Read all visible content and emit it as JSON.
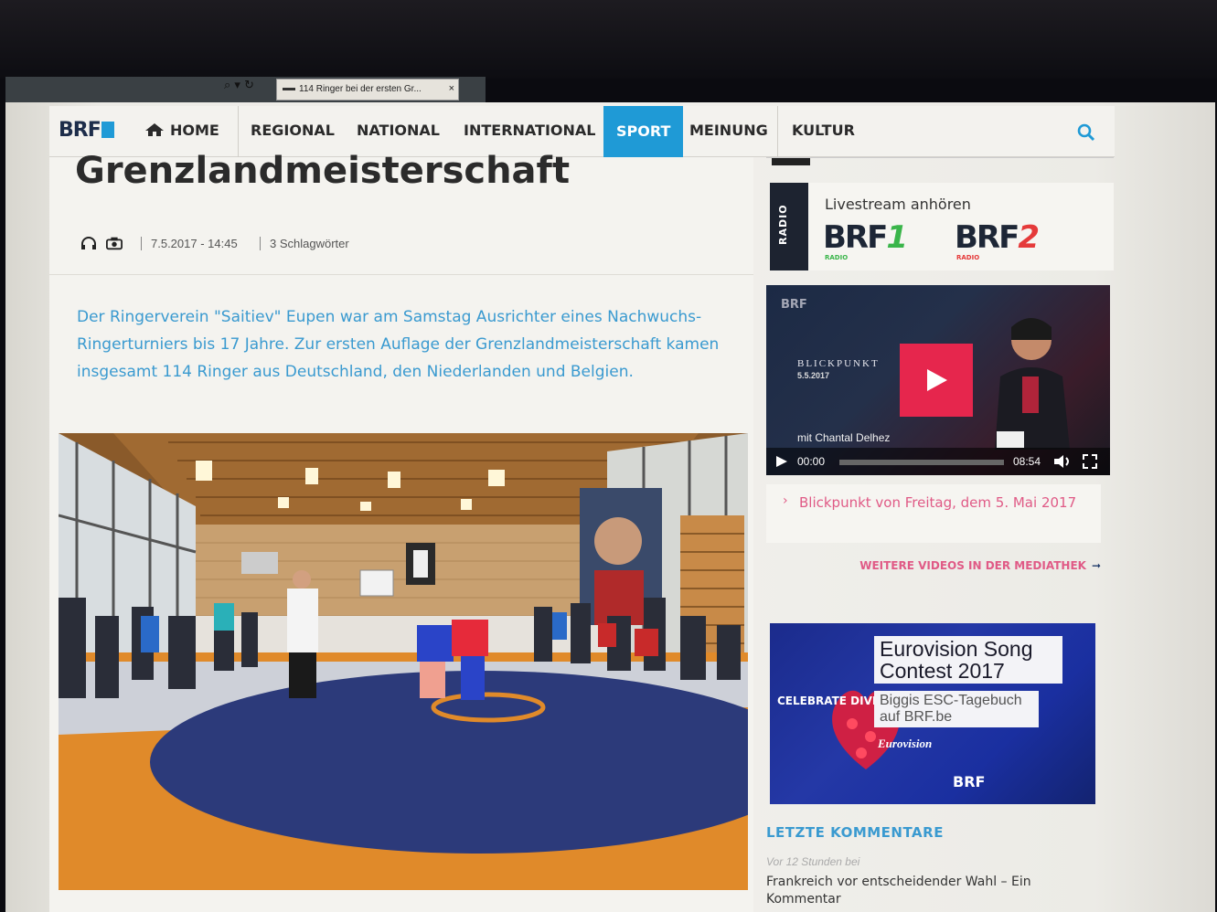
{
  "browser": {
    "tab_title": "114 Ringer bei der ersten Gr...",
    "tab_close": "×",
    "address_icons": "⌕ ▾ ↻"
  },
  "nav": {
    "logo": "BRF",
    "items": [
      "HOME",
      "REGIONAL",
      "NATIONAL",
      "INTERNATIONAL",
      "SPORT",
      "MEINUNG",
      "KULTUR"
    ],
    "active": "SPORT",
    "active_color": "#1f9ad6"
  },
  "article": {
    "title": "Grenzlandmeisterschaft",
    "date": "7.5.2017 - 14:45",
    "tags": "3 Schlagwörter",
    "lead": "Der Ringerverein \"Saitiev\" Eupen war am Samstag Ausrichter eines Nachwuchs-Ringerturniers bis 17 Jahre. Zur ersten Auflage der Grenzlandmeisterschaft kamen insgesamt 114 Ringer aus Deutschland, den Niederlanden und Belgien.",
    "lead_color": "#3a9ad0"
  },
  "sidebar": {
    "radio_tab": "RADIO",
    "radio_title": "Livestream anhören",
    "brf1": {
      "name": "BRF",
      "num": "1",
      "sub": "RADIO",
      "accent": "#3ab54a"
    },
    "brf2": {
      "name": "BRF",
      "num": "2",
      "sub": "RADIO",
      "accent": "#e53a3a"
    },
    "video": {
      "brand": "BRF",
      "show": "BLICKPUNKT",
      "date": "5.5.2017",
      "host": "mit Chantal Delhez",
      "time": "00:00",
      "duration": "08:54",
      "play_color": "#e6264d"
    },
    "video_link": "Blickpunkt von Freitag, dem 5. Mai 2017",
    "more_videos": "WEITERE VIDEOS IN DER MEDIATHEK",
    "esc": {
      "title": "Eurovision Song Contest 2017",
      "subtitle": "Biggis ESC-Tagebuch auf BRF.be",
      "celebrate": "CELEBRATE DIVERSITY",
      "logo_text": "Eurovision",
      "brand": "BRF"
    },
    "comments": {
      "heading": "LETZTE KOMMENTARE",
      "time": "Vor 12 Stunden bei",
      "title": "Frankreich vor entscheidender Wahl – Ein Kommentar"
    }
  }
}
